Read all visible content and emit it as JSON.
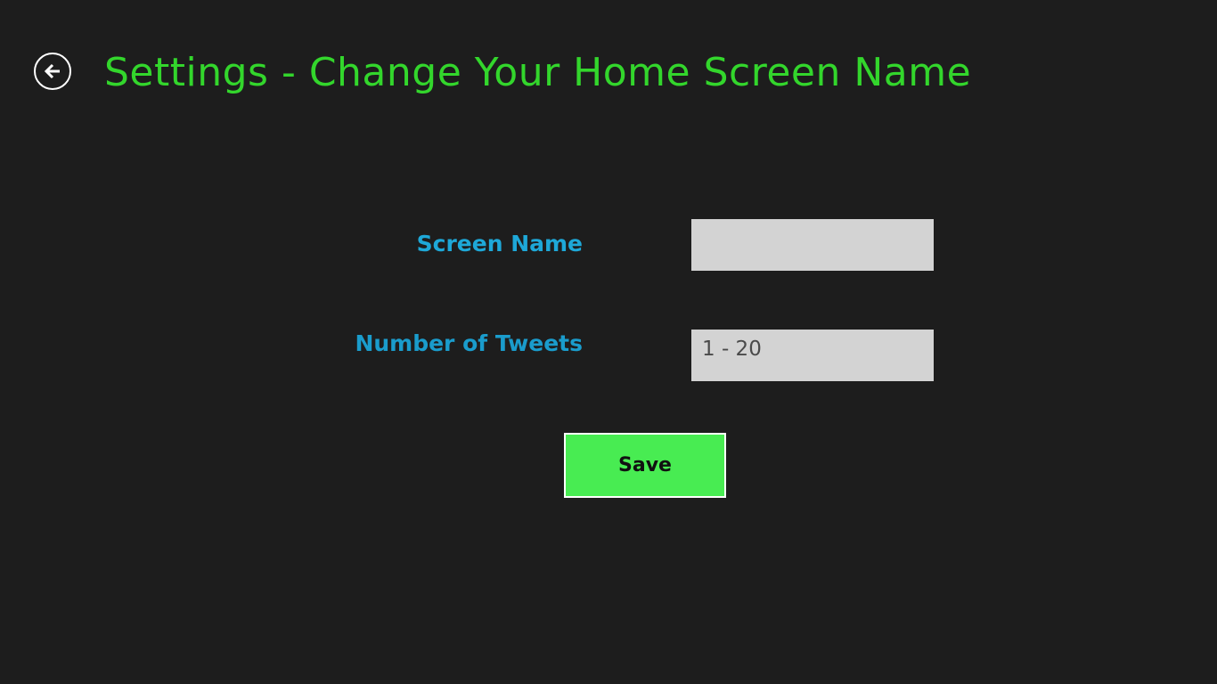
{
  "header": {
    "title": "Settings - Change Your Home Screen Name",
    "back_icon": "back-arrow-icon"
  },
  "form": {
    "screen_name": {
      "label": "Screen Name",
      "value": "",
      "placeholder": ""
    },
    "tweets": {
      "label": "Number of Tweets",
      "value": "",
      "placeholder": "1 - 20"
    },
    "save_label": "Save"
  },
  "colors": {
    "background": "#1d1d1d",
    "title": "#33d62c",
    "label": "#1ea8d8",
    "input_background": "#d3d3d3",
    "save_button": "#48ec52"
  }
}
